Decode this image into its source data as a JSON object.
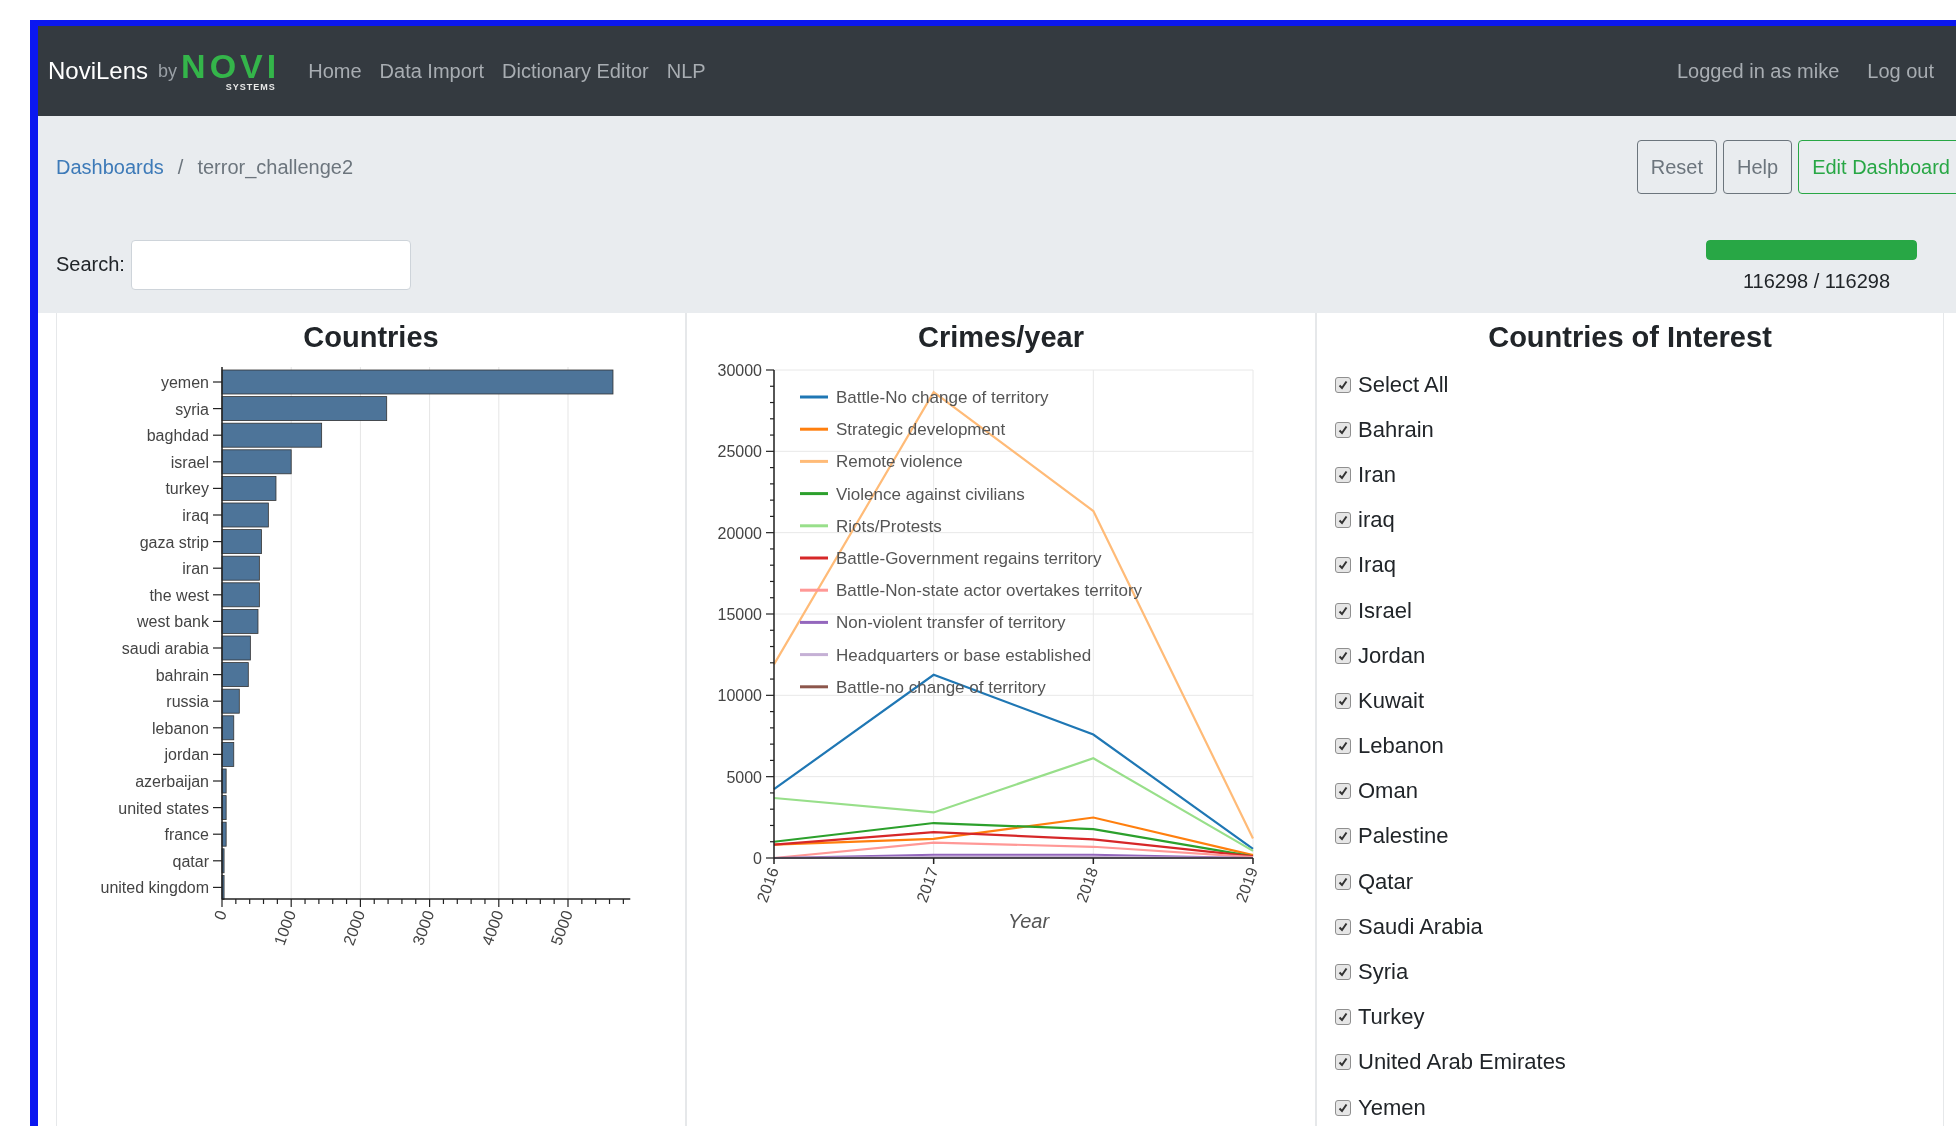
{
  "navbar": {
    "brand": "NoviLens",
    "by": "by",
    "logo": {
      "text": "NOVI",
      "subtext": "SYSTEMS"
    },
    "links": [
      {
        "label": "Home"
      },
      {
        "label": "Data Import"
      },
      {
        "label": "Dictionary Editor"
      },
      {
        "label": "NLP"
      }
    ],
    "user": "Logged in as mike",
    "logout": "Log out"
  },
  "breadcrumb": {
    "items": [
      {
        "label": "Dashboards",
        "link": true
      },
      {
        "label": "terror_challenge2",
        "link": false
      }
    ],
    "separator": "/"
  },
  "actions": [
    {
      "label": "Reset",
      "kind": "secondary"
    },
    {
      "label": "Help",
      "kind": "secondary"
    },
    {
      "label": "Edit Dashboard",
      "kind": "success"
    }
  ],
  "search": {
    "label": "Search:"
  },
  "progress": {
    "level": 1,
    "reading": "116298 / 116298"
  },
  "countries": {
    "chart_data": {
      "type": "bar",
      "orientation": "horizontal",
      "title": "Countries",
      "categories": [
        "yemen",
        "syria",
        "baghdad",
        "israel",
        "turkey",
        "iraq",
        "gaza strip",
        "iran",
        "the west",
        "west bank",
        "saudi arabia",
        "bahrain",
        "russia",
        "lebanon",
        "jordan",
        "azerbaijan",
        "united states",
        "france",
        "qatar",
        "united kingdom"
      ],
      "values": [
        5650,
        2380,
        1440,
        1000,
        780,
        670,
        570,
        540,
        540,
        520,
        410,
        380,
        250,
        170,
        170,
        60,
        60,
        60,
        30,
        30
      ],
      "grid": true,
      "xticks": [
        0,
        1000,
        2000,
        3000,
        4000,
        5000
      ],
      "xlim": [
        0,
        5900
      ]
    }
  },
  "crimes": {
    "chart_data": {
      "type": "line",
      "title": "Crimes/year",
      "xlabel": "Year",
      "x": [
        "2016",
        "2017",
        "2018",
        "2019"
      ],
      "ylim": [
        0,
        30000
      ],
      "yticks": [
        0,
        5000,
        10000,
        15000,
        20000,
        25000,
        30000
      ],
      "grid": true,
      "legend": true,
      "series": [
        {
          "name": "Battle-No change of territory",
          "color": "#1f77b4",
          "values": [
            4230,
            11260,
            7590,
            560
          ]
        },
        {
          "name": "Strategic development",
          "color": "#ff7f0e",
          "values": [
            820,
            1180,
            2490,
            180
          ]
        },
        {
          "name": "Remote violence",
          "color": "#ffbb78",
          "values": [
            11900,
            28640,
            21330,
            1200
          ]
        },
        {
          "name": "Violence against civilians",
          "color": "#2ca02c",
          "values": [
            1000,
            2150,
            1770,
            100
          ]
        },
        {
          "name": "Riots/Protests",
          "color": "#98df8a",
          "values": [
            3690,
            2800,
            6130,
            440
          ]
        },
        {
          "name": "Battle-Government regains territory",
          "color": "#d62728",
          "values": [
            820,
            1590,
            1150,
            100
          ]
        },
        {
          "name": "Battle-Non-state actor overtakes territory",
          "color": "#ff9896",
          "values": [
            0,
            950,
            690,
            50
          ]
        },
        {
          "name": "Non-violent transfer of territory",
          "color": "#9467bd",
          "values": [
            0,
            200,
            200,
            0
          ]
        },
        {
          "name": "Headquarters or base established",
          "color": "#c5b0d5",
          "values": [
            0,
            50,
            50,
            0
          ]
        },
        {
          "name": "Battle-no change of territory",
          "color": "#8c564b",
          "values": [
            null,
            null,
            null,
            null
          ]
        }
      ]
    }
  },
  "interest": {
    "title": "Countries of Interest",
    "items": [
      {
        "label": "Select All",
        "checked": true
      },
      {
        "label": "Bahrain",
        "checked": true
      },
      {
        "label": "Iran",
        "checked": true
      },
      {
        "label": "iraq",
        "checked": true
      },
      {
        "label": "Iraq",
        "checked": true
      },
      {
        "label": "Israel",
        "checked": true
      },
      {
        "label": "Jordan",
        "checked": true
      },
      {
        "label": "Kuwait",
        "checked": true
      },
      {
        "label": "Lebanon",
        "checked": true
      },
      {
        "label": "Oman",
        "checked": true
      },
      {
        "label": "Palestine",
        "checked": true
      },
      {
        "label": "Qatar",
        "checked": true
      },
      {
        "label": "Saudi Arabia",
        "checked": true
      },
      {
        "label": "Syria",
        "checked": true
      },
      {
        "label": "Turkey",
        "checked": true
      },
      {
        "label": "United Arab Emirates",
        "checked": true
      },
      {
        "label": "Yemen",
        "checked": true
      }
    ]
  }
}
